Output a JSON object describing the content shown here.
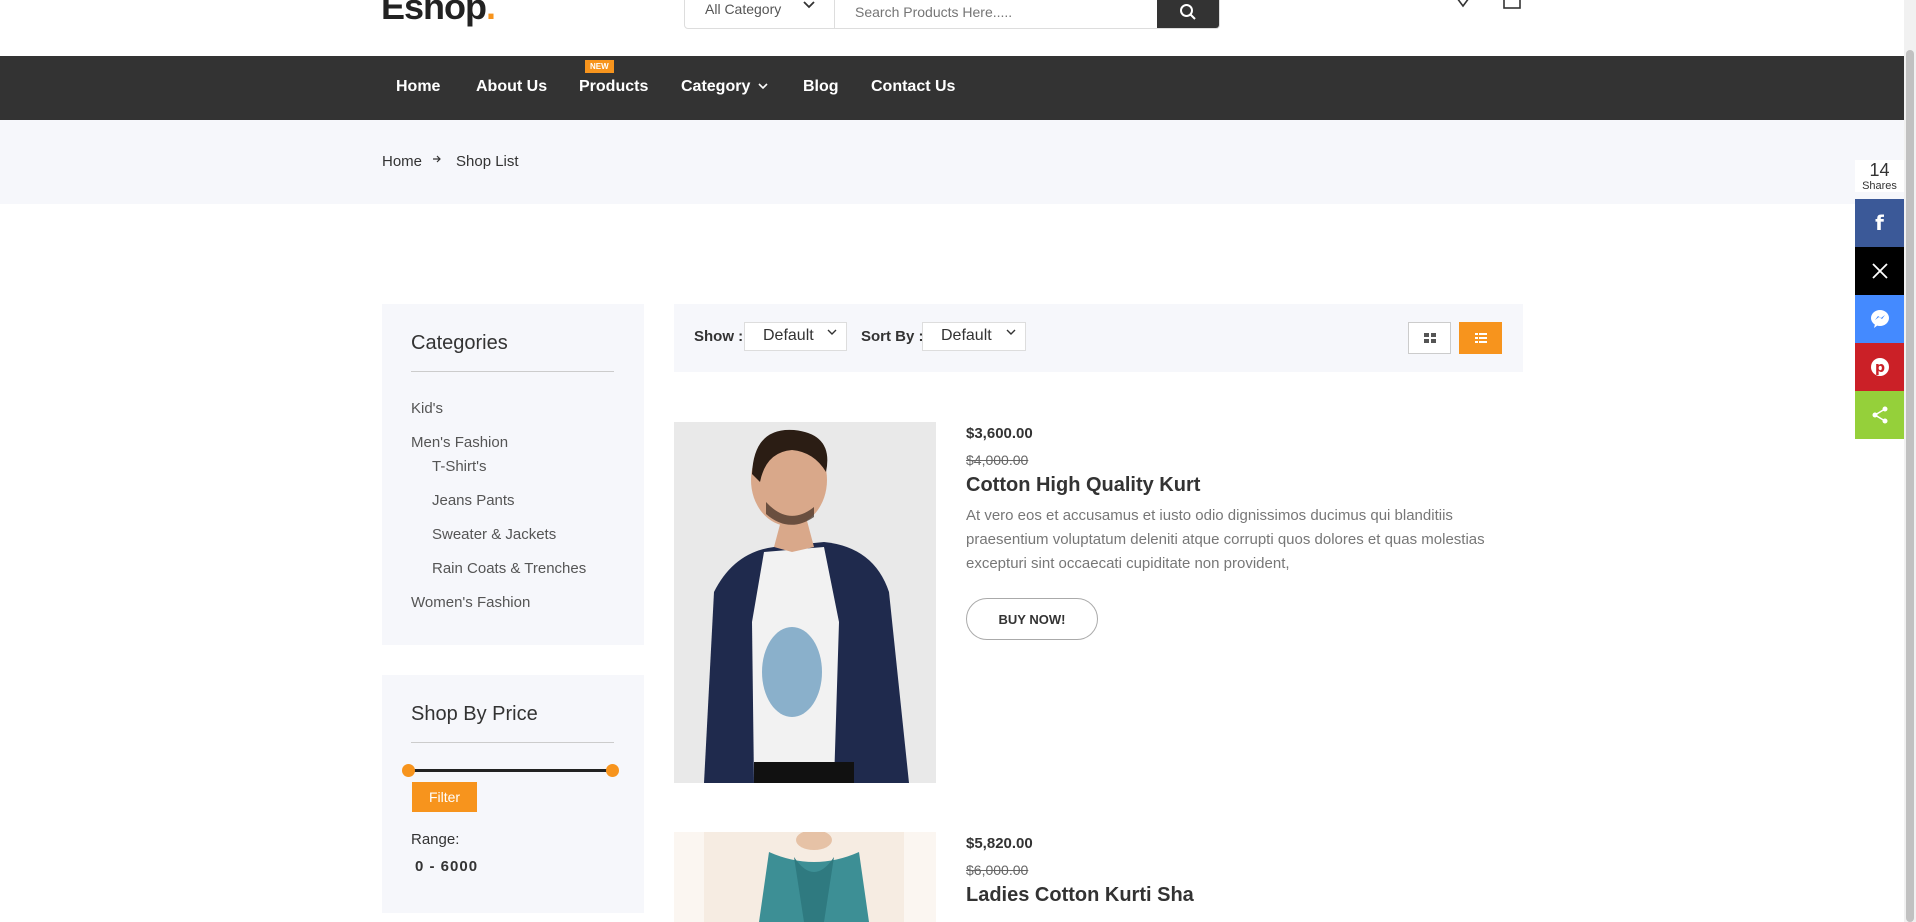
{
  "header": {
    "logo_text": "Eshop",
    "logo_dot": ".",
    "category_select": "All Category",
    "search_placeholder": "Search Products Here....."
  },
  "nav": {
    "items": [
      "Home",
      "About Us",
      "Products",
      "Category",
      "Blog",
      "Contact Us"
    ],
    "new_badge": "NEW"
  },
  "breadcrumb": {
    "home": "Home",
    "current": "Shop List"
  },
  "sidebar": {
    "categories_title": "Categories",
    "categories": [
      "Kid's",
      "Men's Fashion",
      "T-Shirt's",
      "Jeans Pants",
      "Sweater & Jackets",
      "Rain Coats & Trenches",
      "Women's Fashion"
    ],
    "price_title": "Shop By Price",
    "price_range_min": 0,
    "price_range_max": 1,
    "filter_label": "Filter",
    "range_label": "Range:",
    "range_value": "0  -  6000"
  },
  "toolbar": {
    "show_label": "Show :",
    "show_value": "Default",
    "sort_label": "Sort By :",
    "sort_value": "Default"
  },
  "products": [
    {
      "price": "$3,600.00",
      "old_price": "$4,000.00",
      "title": "Cotton High Quality Kurt",
      "description": "At vero eos et accusamus et iusto odio dignissimos ducimus qui blanditiis praesentium voluptatum deleniti atque corrupti quos dolores et quas molestias excepturi sint occaecati cupiditate non provident,",
      "button": "BUY NOW!"
    },
    {
      "price": "$5,820.00",
      "old_price": "$6,000.00",
      "title": "Ladies Cotton Kurti Sha"
    }
  ],
  "share": {
    "count": "14",
    "label": "Shares",
    "colors": {
      "facebook": "#3b5998",
      "x": "#000000",
      "messenger": "#448aff",
      "pinterest": "#cb2027",
      "share": "#95d03a"
    }
  },
  "colors": {
    "accent": "#f7941d",
    "nav_bg": "#333333"
  }
}
